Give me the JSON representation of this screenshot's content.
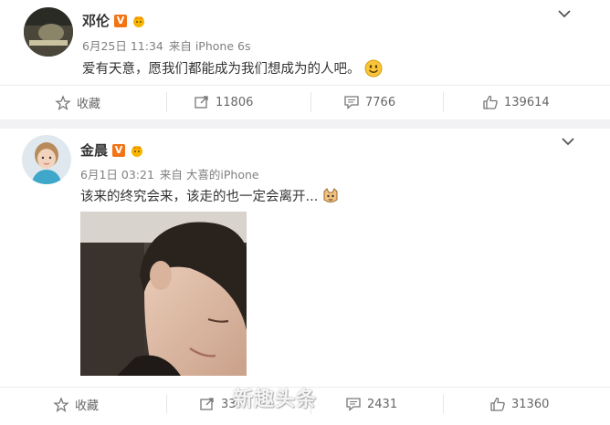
{
  "posts": [
    {
      "user": "邓伦",
      "verified_badge": "V",
      "date": "6月25日 11:34",
      "source": "来自 iPhone 6s",
      "text": "爱有天意，愿我们都能成为我们想成为的人吧。",
      "emoji": "smile-emoji",
      "actions": {
        "favorite_label": "收藏",
        "repost_count": "11806",
        "comment_count": "7766",
        "like_count": "139614"
      }
    },
    {
      "user": "金晨",
      "verified_badge": "V",
      "date": "6月1日 03:21",
      "source": "来自 大喜的iPhone",
      "text": "该来的终究会来，该走的也一定会离开...",
      "emoji": "cat-emoji",
      "actions": {
        "favorite_label": "收藏",
        "repost_count": "33",
        "comment_count": "2431",
        "like_count": "31360"
      }
    }
  ],
  "watermark": "新趣头条",
  "colors": {
    "badge": "#f27415",
    "meta": "#808080",
    "text": "#333333",
    "separator": "#f2f2f5"
  }
}
